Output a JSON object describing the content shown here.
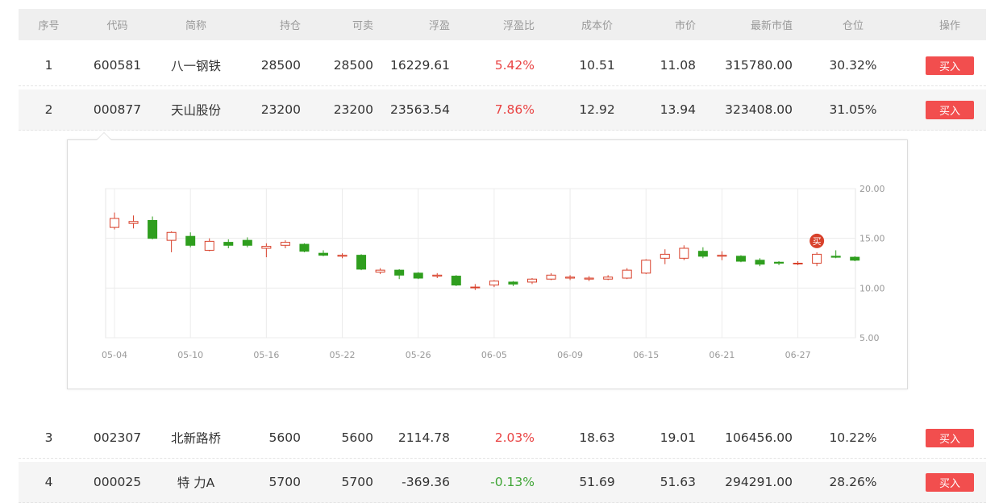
{
  "table": {
    "headers": [
      "序号",
      "代码",
      "简称",
      "持仓",
      "可卖",
      "浮盈",
      "浮盈比",
      "成本价",
      "市价",
      "最新市值",
      "仓位",
      "操作"
    ],
    "rows": [
      {
        "idx": "1",
        "code": "600581",
        "name": "八一钢铁",
        "hold": "28500",
        "sell": "28500",
        "pl": "16229.61",
        "plr": "5.42%",
        "cost": "10.51",
        "price": "11.08",
        "mv": "315780.00",
        "pos": "30.32%",
        "action": "买入"
      },
      {
        "idx": "2",
        "code": "000877",
        "name": "天山股份",
        "hold": "23200",
        "sell": "23200",
        "pl": "23563.54",
        "plr": "7.86%",
        "cost": "12.92",
        "price": "13.94",
        "mv": "323408.00",
        "pos": "31.05%",
        "action": "买入"
      },
      {
        "idx": "3",
        "code": "002307",
        "name": "北新路桥",
        "hold": "5600",
        "sell": "5600",
        "pl": "2114.78",
        "plr": "2.03%",
        "cost": "18.63",
        "price": "19.01",
        "mv": "106456.00",
        "pos": "10.22%",
        "action": "买入"
      },
      {
        "idx": "4",
        "code": "000025",
        "name": "特 力A",
        "hold": "5700",
        "sell": "5700",
        "pl": "-369.36",
        "plr": "-0.13%",
        "cost": "51.69",
        "price": "51.63",
        "mv": "294291.00",
        "pos": "28.26%",
        "action": "买入"
      }
    ]
  },
  "colors": {
    "up": "#d8412b",
    "down": "#2f9e1e",
    "buy_button": "#f24e4e",
    "profit": "#e94343",
    "loss": "#3fa535"
  },
  "chart_data": {
    "type": "candlestick",
    "for_stock": "000877",
    "ylim": [
      5,
      20
    ],
    "yticks": [
      "20.00",
      "15.00",
      "10.00",
      "5.00"
    ],
    "xtick_labels": [
      "05-04",
      "05-10",
      "05-16",
      "05-22",
      "05-26",
      "06-05",
      "06-09",
      "06-15",
      "06-21",
      "06-27"
    ],
    "xtick_positions": [
      0,
      4,
      8,
      12,
      16,
      20,
      24,
      28,
      32,
      36
    ],
    "candles": [
      {
        "o": 16.1,
        "c": 17.0,
        "h": 17.6,
        "l": 15.9
      },
      {
        "o": 16.5,
        "c": 16.7,
        "h": 17.3,
        "l": 16.0
      },
      {
        "o": 16.8,
        "c": 15.0,
        "h": 17.2,
        "l": 14.9
      },
      {
        "o": 14.8,
        "c": 15.6,
        "h": 15.7,
        "l": 13.6
      },
      {
        "o": 15.2,
        "c": 14.3,
        "h": 15.6,
        "l": 14.1
      },
      {
        "o": 13.8,
        "c": 14.7,
        "h": 15.0,
        "l": 13.7
      },
      {
        "o": 14.6,
        "c": 14.3,
        "h": 14.9,
        "l": 14.0
      },
      {
        "o": 14.8,
        "c": 14.3,
        "h": 15.1,
        "l": 14.1
      },
      {
        "o": 14.0,
        "c": 14.2,
        "h": 14.5,
        "l": 13.1
      },
      {
        "o": 14.3,
        "c": 14.6,
        "h": 14.8,
        "l": 14.0
      },
      {
        "o": 14.4,
        "c": 13.7,
        "h": 14.5,
        "l": 13.6
      },
      {
        "o": 13.5,
        "c": 13.3,
        "h": 13.8,
        "l": 13.2
      },
      {
        "o": 13.2,
        "c": 13.3,
        "h": 13.5,
        "l": 13.0
      },
      {
        "o": 13.3,
        "c": 11.9,
        "h": 13.4,
        "l": 11.8
      },
      {
        "o": 11.6,
        "c": 11.8,
        "h": 12.0,
        "l": 11.4
      },
      {
        "o": 11.8,
        "c": 11.3,
        "h": 11.9,
        "l": 10.9
      },
      {
        "o": 11.5,
        "c": 11.0,
        "h": 11.6,
        "l": 10.9
      },
      {
        "o": 11.2,
        "c": 11.3,
        "h": 11.5,
        "l": 11.0
      },
      {
        "o": 11.2,
        "c": 10.3,
        "h": 11.3,
        "l": 10.2
      },
      {
        "o": 10.1,
        "c": 10.1,
        "h": 10.4,
        "l": 9.8
      },
      {
        "o": 10.3,
        "c": 10.7,
        "h": 10.8,
        "l": 10.1
      },
      {
        "o": 10.6,
        "c": 10.4,
        "h": 10.7,
        "l": 10.2
      },
      {
        "o": 10.6,
        "c": 10.9,
        "h": 11.0,
        "l": 10.4
      },
      {
        "o": 10.9,
        "c": 11.3,
        "h": 11.5,
        "l": 10.8
      },
      {
        "o": 11.0,
        "c": 11.1,
        "h": 11.3,
        "l": 10.8
      },
      {
        "o": 10.9,
        "c": 11.0,
        "h": 11.2,
        "l": 10.7
      },
      {
        "o": 10.9,
        "c": 11.1,
        "h": 11.3,
        "l": 10.8
      },
      {
        "o": 11.0,
        "c": 11.8,
        "h": 12.0,
        "l": 10.9
      },
      {
        "o": 11.5,
        "c": 12.8,
        "h": 12.9,
        "l": 11.4
      },
      {
        "o": 13.0,
        "c": 13.4,
        "h": 13.9,
        "l": 12.4
      },
      {
        "o": 13.0,
        "c": 14.0,
        "h": 14.3,
        "l": 12.8
      },
      {
        "o": 13.7,
        "c": 13.2,
        "h": 14.1,
        "l": 13.0
      },
      {
        "o": 13.2,
        "c": 13.3,
        "h": 13.7,
        "l": 12.8
      },
      {
        "o": 13.2,
        "c": 12.7,
        "h": 13.3,
        "l": 12.6
      },
      {
        "o": 12.8,
        "c": 12.4,
        "h": 13.0,
        "l": 12.2
      },
      {
        "o": 12.6,
        "c": 12.5,
        "h": 12.7,
        "l": 12.3
      },
      {
        "o": 12.5,
        "c": 12.5,
        "h": 12.7,
        "l": 12.3
      },
      {
        "o": 12.5,
        "c": 13.4,
        "h": 13.6,
        "l": 12.2
      },
      {
        "o": 13.2,
        "c": 13.1,
        "h": 13.8,
        "l": 13.0
      },
      {
        "o": 13.1,
        "c": 12.8,
        "h": 13.2,
        "l": 12.7
      }
    ],
    "buy_marker": {
      "index": 37,
      "label": "买"
    }
  }
}
